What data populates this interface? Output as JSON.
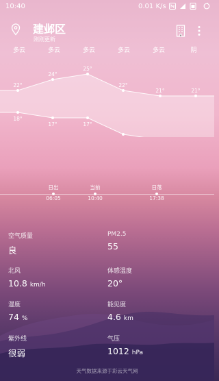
{
  "status_bar": {
    "time": "10:40",
    "network_speed": "0.01 K/s"
  },
  "header": {
    "city": "建邺区",
    "updated": "刚刚更新"
  },
  "forecast": [
    {
      "condition": "多云",
      "high": 22,
      "low": 18
    },
    {
      "condition": "多云",
      "high": 24,
      "low": 17
    },
    {
      "condition": "多云",
      "high": 25,
      "low": 17
    },
    {
      "condition": "多云",
      "high": 22,
      "low": 14
    },
    {
      "condition": "多云",
      "high": 21,
      "low": 13
    },
    {
      "condition": "阴",
      "high": 21,
      "low": 13
    }
  ],
  "forecast_labels": {
    "high": [
      "22°",
      "24°",
      "25°",
      "22°",
      "21°",
      "21°"
    ],
    "low": [
      "18°",
      "17°",
      "17°",
      "14°",
      "13°",
      "13°"
    ]
  },
  "sun": {
    "sunrise_label": "日出",
    "sunrise_time": "06:05",
    "now_label": "当前",
    "now_time": "10:40",
    "sunset_label": "日落",
    "sunset_time": "17:38"
  },
  "details": {
    "air_quality": {
      "label": "空气质量",
      "value": "良"
    },
    "pm25": {
      "label": "PM2.5",
      "value": "55"
    },
    "wind": {
      "label": "北风",
      "value": "10.8",
      "unit": "km/h"
    },
    "feels_like": {
      "label": "体感温度",
      "value": "20°"
    },
    "humidity": {
      "label": "湿度",
      "value": "74",
      "unit": "%"
    },
    "visibility": {
      "label": "能见度",
      "value": "4.6",
      "unit": "km"
    },
    "uv": {
      "label": "紫外线",
      "value": "很弱"
    },
    "pressure": {
      "label": "气压",
      "value": "1012",
      "unit": "hPa"
    }
  },
  "footer": "天气数据来源于彩云天气网",
  "colors": {
    "accent": "#ffffff",
    "band": "#ffffff"
  }
}
